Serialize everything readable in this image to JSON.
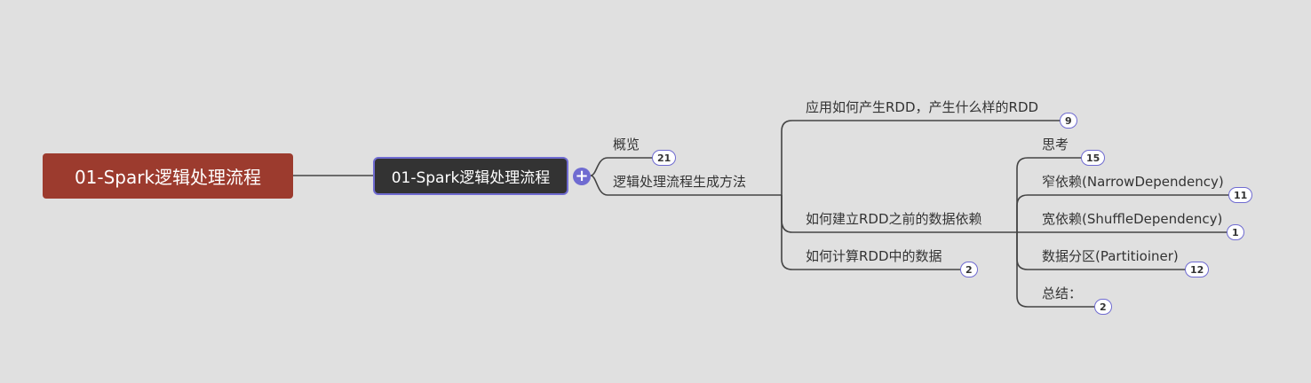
{
  "root": {
    "label": "01-Spark逻辑处理流程"
  },
  "main": {
    "label": "01-Spark逻辑处理流程",
    "expand_icon": "plus-icon"
  },
  "branches": {
    "overview": {
      "label": "概览",
      "count": "21"
    },
    "method": {
      "label": "逻辑处理流程生成方法"
    }
  },
  "method_children": {
    "app_rdd": {
      "label": "应用如何产生RDD，产生什么样的RDD",
      "count": "9"
    },
    "dependency": {
      "label": "如何建立RDD之前的数据依赖"
    },
    "compute": {
      "label": "如何计算RDD中的数据",
      "count": "2"
    }
  },
  "dependency_children": {
    "thinking": {
      "label": "思考",
      "count": "15"
    },
    "narrow": {
      "label": "窄依赖(NarrowDependency)",
      "count": "11"
    },
    "shuffle": {
      "label": "宽依赖(ShuffleDependency)",
      "count": "1"
    },
    "partitioner": {
      "label": "数据分区(Partitioiner)",
      "count": "12"
    },
    "summary": {
      "label": "总结：",
      "count": "2"
    }
  },
  "colors": {
    "root": "#9c3b2e",
    "main": "#333333",
    "accent": "#6f6bd1",
    "line": "#444444"
  }
}
